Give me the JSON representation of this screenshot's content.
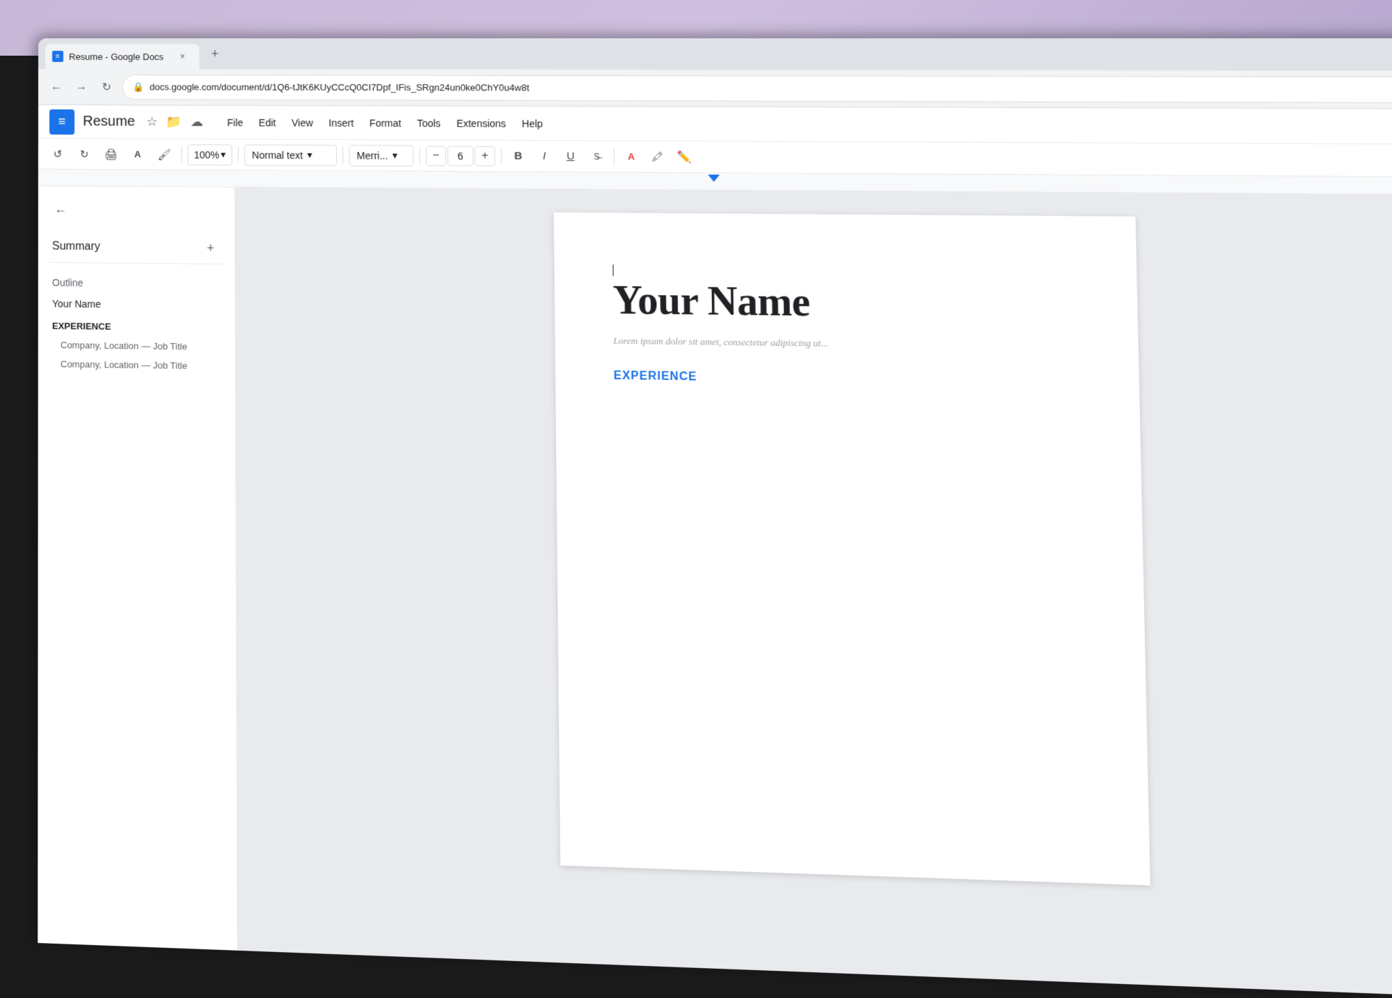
{
  "browser": {
    "tab": {
      "title": "Resume - Google Docs",
      "favicon": "docs-icon",
      "close_label": "×",
      "new_tab_label": "+"
    },
    "address_bar": {
      "url": "docs.google.com/document/d/1Q6-tJtK6KUyCCcQ0CI7Dpf_IFis_SRgn24un0ke0ChY0u4w8t",
      "lock_icon": "🔒"
    },
    "nav": {
      "back_label": "←",
      "forward_label": "→",
      "refresh_label": "↻"
    }
  },
  "app": {
    "title": "Resume",
    "doc_icon": "≡",
    "star_icon": "☆",
    "save_cloud_icon": "☁",
    "folder_icon": "📁",
    "menu_items": [
      "File",
      "Edit",
      "View",
      "Insert",
      "Format",
      "Tools",
      "Extensions",
      "Help"
    ]
  },
  "toolbar": {
    "undo_label": "↺",
    "redo_label": "↻",
    "print_label": "🖨",
    "spell_label": "A",
    "paint_format_label": "🖌",
    "zoom": "100%",
    "zoom_arrow": "▾",
    "style": "Normal text",
    "style_arrow": "▾",
    "font": "Merri...",
    "font_arrow": "▾",
    "font_size_minus": "−",
    "font_size_value": "6",
    "font_size_plus": "+",
    "bold_label": "B",
    "italic_label": "I",
    "underline_label": "U",
    "strikethrough_label": "S"
  },
  "sidebar": {
    "back_btn": "←",
    "summary_label": "Summary",
    "add_btn": "+",
    "outline_label": "Outline",
    "outline_items": [
      {
        "label": "Your Name",
        "level": "normal"
      },
      {
        "label": "EXPERIENCE",
        "level": "heading"
      },
      {
        "label": "Company, Location — Job Title",
        "level": "sub"
      },
      {
        "label": "Company, Location — Job Title",
        "level": "sub"
      }
    ]
  },
  "document": {
    "cursor_visible": true,
    "name_heading": "Your Name",
    "lorem_text": "Lorem ipsum dolor sit amet, consectetur adipiscing ut...",
    "experience_heading": "EXPERIENCE"
  }
}
